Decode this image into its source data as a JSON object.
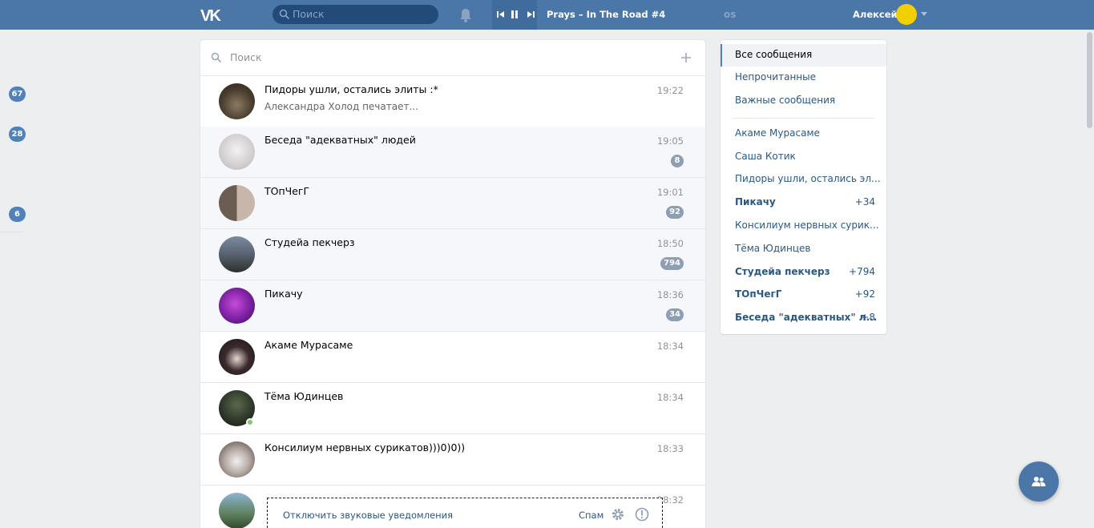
{
  "header": {
    "search_placeholder": "Поиск",
    "track": "Prays – In The Road #4",
    "os_label": "os",
    "user_name": "Алексей"
  },
  "left_counters": [
    "67",
    "28",
    "6"
  ],
  "list": {
    "search_placeholder": "Поиск",
    "rows": [
      {
        "title": "Пидоры ушли, остались элиты :*",
        "sub": "Александра Холод печатает...",
        "time": "19:22",
        "badge": ""
      },
      {
        "title": "Беседа \"адекватных\" людей",
        "sub": "",
        "time": "19:05",
        "badge": "8"
      },
      {
        "title": "ТОпЧегГ",
        "sub": "",
        "time": "19:01",
        "badge": "92"
      },
      {
        "title": "Студейа пекчерз",
        "sub": "",
        "time": "18:50",
        "badge": "794"
      },
      {
        "title": "Пикачу",
        "sub": "",
        "time": "18:36",
        "badge": "34"
      },
      {
        "title": "Акаме Мурасаме",
        "sub": "",
        "time": "18:34",
        "badge": ""
      },
      {
        "title": "Тёма Юдинцев",
        "sub": "",
        "time": "18:34",
        "badge": ""
      },
      {
        "title": "Консилиум нервных сурикатов)))0)0))",
        "sub": "",
        "time": "18:33",
        "badge": ""
      },
      {
        "title": "",
        "sub": "",
        "time": "18:32",
        "badge": ""
      }
    ]
  },
  "notification_bar": {
    "mute_label": "Отключить звуковые уведомления",
    "spam_label": "Спам"
  },
  "right_menu": {
    "items": [
      {
        "label": "Все сообщения",
        "count": ""
      },
      {
        "label": "Непрочитанные",
        "count": ""
      },
      {
        "label": "Важные сообщения",
        "count": ""
      }
    ],
    "chats": [
      {
        "label": "Акаме Мурасаме",
        "count": ""
      },
      {
        "label": "Саша Котик",
        "count": ""
      },
      {
        "label": "Пидоры ушли, остались эл...",
        "count": ""
      },
      {
        "label": "Пикачу",
        "count": "+34"
      },
      {
        "label": "Консилиум нервных сурик...",
        "count": ""
      },
      {
        "label": "Тёма Юдинцев",
        "count": ""
      },
      {
        "label": "Студейа пекчерз",
        "count": "+794"
      },
      {
        "label": "ТОпЧегГ",
        "count": "+92"
      },
      {
        "label": "Беседа \"адекватных\" л...",
        "count": "+8"
      }
    ]
  },
  "colors": {
    "header_bg": "#4a76a8",
    "accent": "#5181b8",
    "link": "#2a5885",
    "unread_bg": "#f5f7fa",
    "online": "#8ac176"
  },
  "icons": [
    "vk-logo-icon",
    "search-icon",
    "bell-icon",
    "prev-track-icon",
    "pause-icon",
    "next-track-icon",
    "user-avatar",
    "dropdown-arrow-icon",
    "plus-icon",
    "gear-icon",
    "info-icon",
    "group-people-icon"
  ]
}
